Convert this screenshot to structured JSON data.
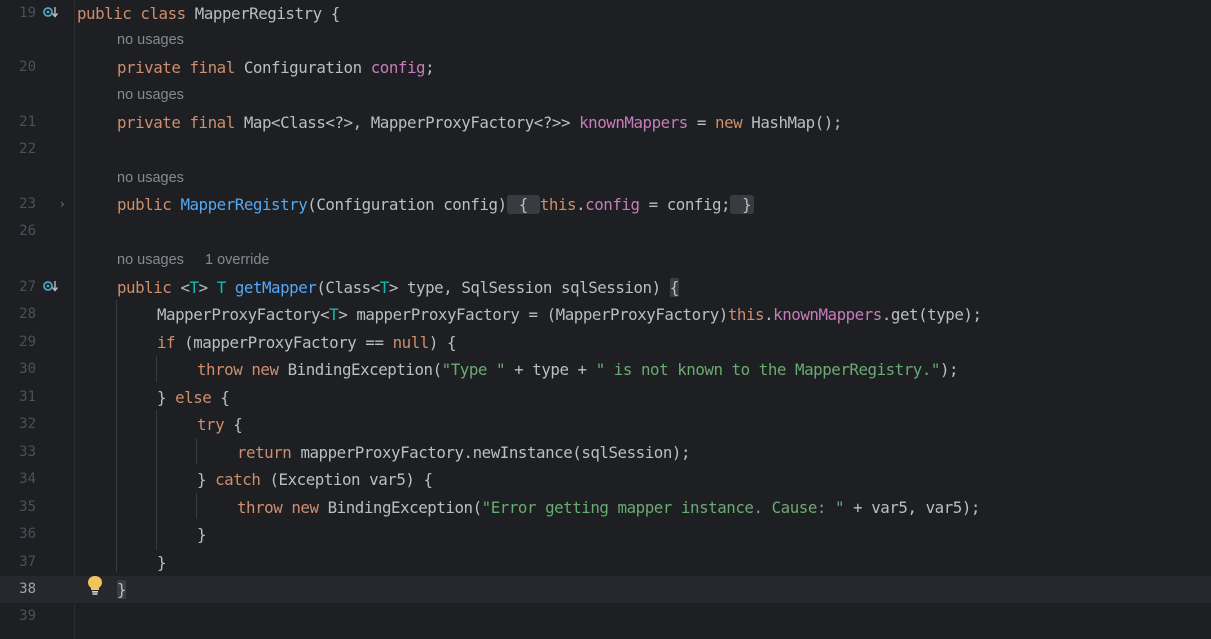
{
  "editor": {
    "lines": [
      {
        "num": "19",
        "text": "public class MapperRegistry {"
      },
      {
        "num": "20",
        "text": "private final Configuration config;"
      },
      {
        "num": "21",
        "text": "private final Map<Class<?>, MapperProxyFactory<?>> knownMappers = new HashMap();"
      },
      {
        "num": "22",
        "text": ""
      },
      {
        "num": "23",
        "text": "public MapperRegistry(Configuration config) { this.config = config; }"
      },
      {
        "num": "26",
        "text": ""
      },
      {
        "num": "27",
        "text": "public <T> T getMapper(Class<T> type, SqlSession sqlSession) {"
      },
      {
        "num": "28",
        "text": "MapperProxyFactory<T> mapperProxyFactory = (MapperProxyFactory)this.knownMappers.get(type);"
      },
      {
        "num": "29",
        "text": "if (mapperProxyFactory == null) {"
      },
      {
        "num": "30",
        "text": "throw new BindingException(\"Type \" + type + \" is not known to the MapperRegistry.\");"
      },
      {
        "num": "31",
        "text": "} else {"
      },
      {
        "num": "32",
        "text": "try {"
      },
      {
        "num": "33",
        "text": "return mapperProxyFactory.newInstance(sqlSession);"
      },
      {
        "num": "34",
        "text": "} catch (Exception var5) {"
      },
      {
        "num": "35",
        "text": "throw new BindingException(\"Error getting mapper instance. Cause: \" + var5, var5);"
      },
      {
        "num": "36",
        "text": "}"
      },
      {
        "num": "37",
        "text": "}"
      },
      {
        "num": "38",
        "text": "}"
      },
      {
        "num": "39",
        "text": ""
      }
    ],
    "hints": {
      "usages_a": "no usages",
      "usages_b": "no usages",
      "usages_c": "no usages",
      "usages_d": "no usages",
      "override_d": "1 override"
    },
    "current_line": "38",
    "colors": {
      "background": "#1e1f22",
      "keyword": "#cf8e6d",
      "function": "#56a8f5",
      "field": "#c77dbb",
      "string": "#6aab73",
      "type_param": "#16baac",
      "text": "#bcbec4"
    },
    "icons": [
      "implementation-marker-icon",
      "fold-arrow-icon",
      "lightbulb-icon"
    ]
  }
}
